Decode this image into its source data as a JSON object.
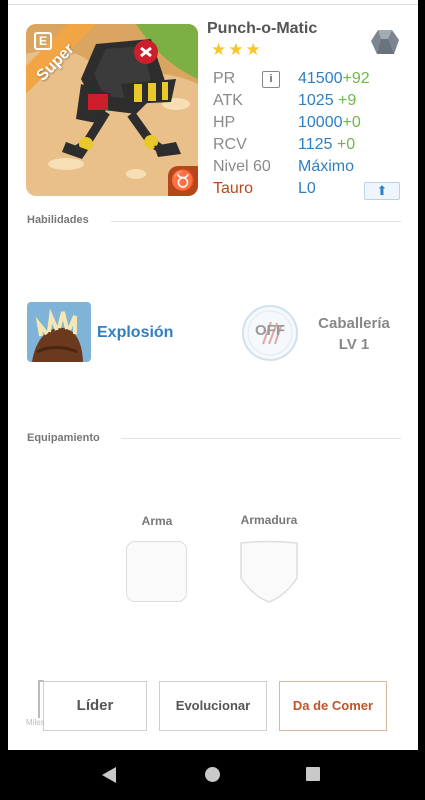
{
  "unit": {
    "name": "Punch-o-Matic",
    "rarity_label": "Super",
    "stars": "★★★",
    "element_icon": "rock-gem-icon",
    "corner_letter": "E"
  },
  "stats": {
    "pr_label": "PR",
    "pr_value": "41500",
    "pr_bonus": "+92",
    "atk_label": "ATK",
    "atk_value": "1025",
    "atk_bonus": "+9",
    "hp_label": "HP",
    "hp_value": "10000",
    "hp_bonus": "+0",
    "rcv_label": "RCV",
    "rcv_value": "1125",
    "rcv_bonus": "+0",
    "level_label": "Nivel 60",
    "level_value": "Máximo",
    "sign_label": "Tauro",
    "sign_value": "L0",
    "info_glyph": "i",
    "sign_glyph": "♉"
  },
  "skills": {
    "section_title": "Habilidades",
    "active_name": "Explosión",
    "passive_status": "OFF",
    "passive_name": "Caballería",
    "passive_level": "LV 1"
  },
  "equipment": {
    "section_title": "Equipamiento",
    "weapon_label": "Arma",
    "armor_label": "Armadura"
  },
  "buttons": {
    "leader": "Líder",
    "evolve": "Evolucionar",
    "feed": "Da de Comer"
  },
  "watermark": "Miles",
  "colors": {
    "accent_blue": "#2f7fc2",
    "bonus_green": "#6cb94a",
    "sign_orange": "#b5481b",
    "star_yellow": "#f7c52c"
  }
}
